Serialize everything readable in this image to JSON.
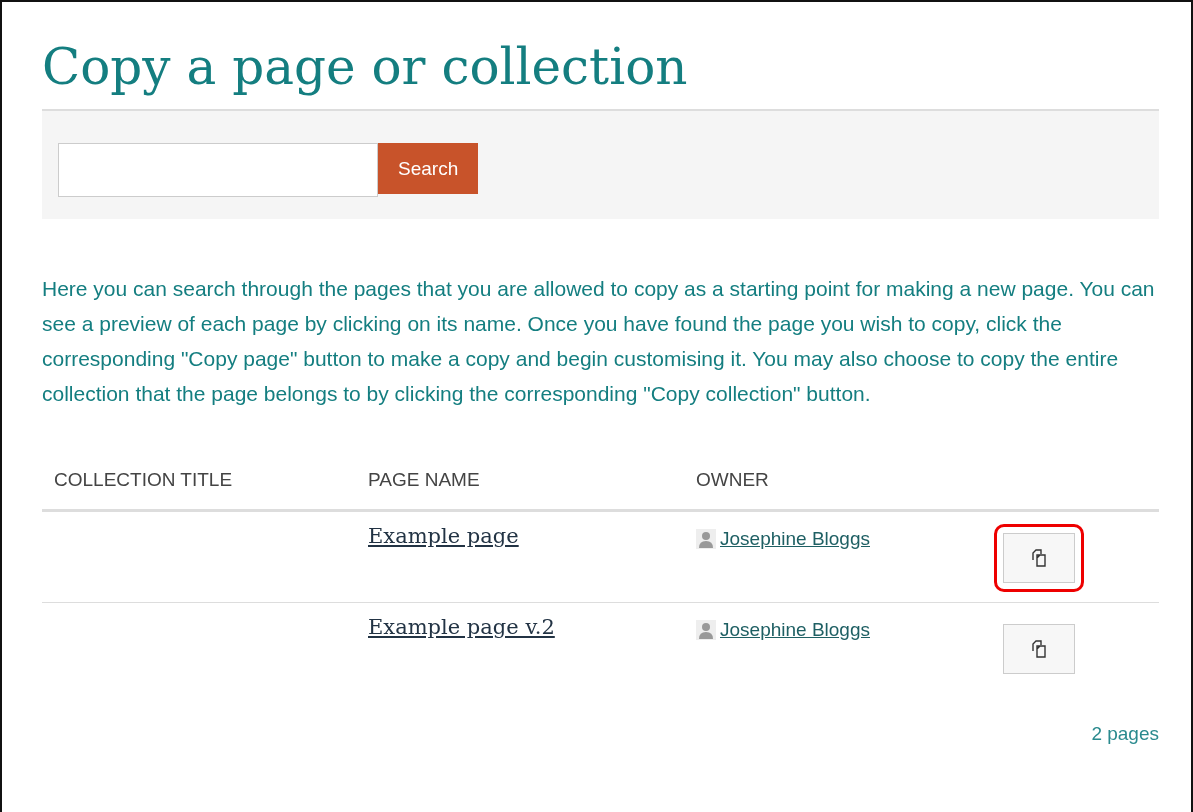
{
  "title": "Copy a page or collection",
  "search": {
    "button": "Search"
  },
  "description": "Here you can search through the pages that you are allowed to copy as a starting point for making a new page. You can see a preview of each page by clicking on its name. Once you have found the page you wish to copy, click the corresponding \"Copy page\" button to make a copy and begin customising it. You may also choose to copy the entire collection that the page belongs to by clicking the corresponding \"Copy collection\" button.",
  "table": {
    "columns": [
      "COLLECTION TITLE",
      "PAGE NAME",
      "OWNER"
    ],
    "rows": [
      {
        "page_name": "Example page",
        "owner": "Josephine Bloggs",
        "highlighted": true
      },
      {
        "page_name": "Example page v.2",
        "owner": "Josephine Bloggs",
        "highlighted": false
      }
    ]
  },
  "count": "2 pages"
}
